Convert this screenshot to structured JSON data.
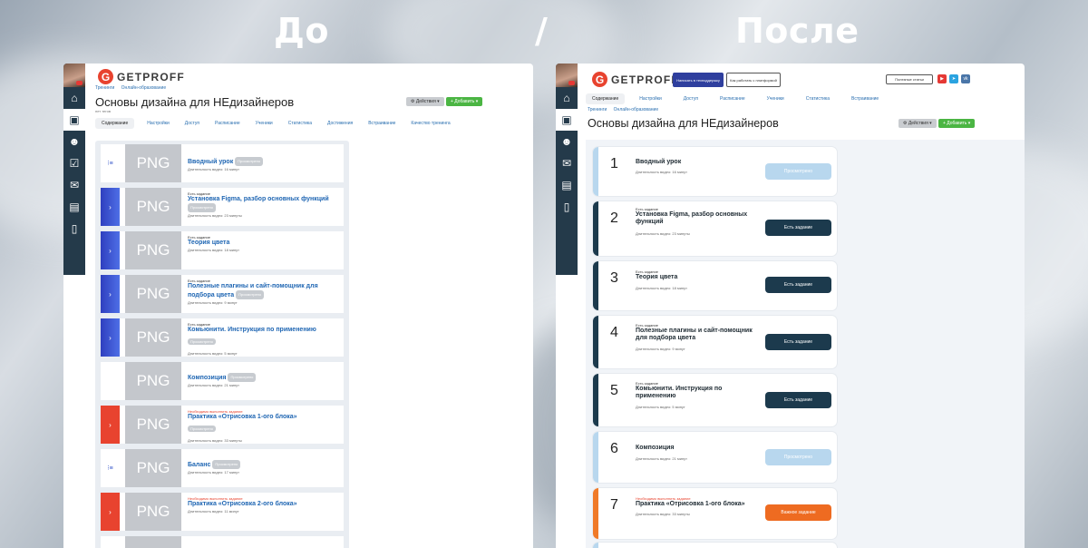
{
  "headings": {
    "before": "До",
    "separator": "/",
    "after": "После"
  },
  "brand": {
    "logo_letter": "G",
    "logo_text": "GETPROFF"
  },
  "colors": {
    "accent_orange": "#e8432f",
    "navy": "#1c3a4d",
    "green": "#4bb543",
    "link_blue": "#1f66b3",
    "light_blue": "#b8d7ee"
  },
  "rail_icons": [
    "home-icon",
    "training-icon",
    "users-icon",
    "tasks-icon",
    "mail-icon",
    "chat-icon",
    "phone-icon"
  ],
  "before": {
    "crumbs": [
      "Тренинги",
      "Онлайн-образование"
    ],
    "title": "Основы дизайна для НЕдизайнеров",
    "subtitle": "нет тегов",
    "actions_label": "Действия",
    "add_label": "+ Добавить",
    "tabs": [
      "Содержание",
      "Настройки",
      "Доступ",
      "Расписание",
      "Ученики",
      "Статистика",
      "Достижения",
      "Встраивание",
      "Качество тренинга"
    ],
    "lessons": [
      {
        "marker": "plain",
        "glyph": "⁝≡",
        "img": "PNG",
        "status": "",
        "title": "Вводный урок",
        "tag": "Просмотрено",
        "dur": "Длительность видео: 16 минут"
      },
      {
        "marker": "blue",
        "glyph": "›",
        "img": "PNG",
        "status": "Есть задание",
        "title": "Установка Figma, разбор основных функций",
        "tag": "Просмотрено",
        "dur": "Длительность видео: 23 минуты"
      },
      {
        "marker": "blue",
        "glyph": "›",
        "img": "PNG",
        "status": "Есть задание",
        "title": "Теория цвета",
        "tag": "",
        "dur": "Длительность видео: 18 минут"
      },
      {
        "marker": "blue",
        "glyph": "›",
        "img": "PNG",
        "status": "Есть задание",
        "title": "Полезные плагины и сайт-помощник для подбора цвета",
        "tag": "Просмотрено",
        "dur": "Длительность видео: 9 минут"
      },
      {
        "marker": "blue",
        "glyph": "›",
        "img": "PNG",
        "status": "Есть задание",
        "title": "Комьюнити. Инструкция по применению",
        "tag": "Просмотрено",
        "dur": "Длительность видео: 5 минут"
      },
      {
        "marker": "plain",
        "glyph": "",
        "img": "PNG",
        "status": "",
        "title": "Композиция",
        "tag": "Просмотрено",
        "dur": "Длительность видео: 21 минут"
      },
      {
        "marker": "red",
        "glyph": "›",
        "img": "PNG",
        "status": "Необходимо выполнить задание",
        "title": "Практика «Отрисовка 1-ого блока»",
        "tag": "Просмотрено",
        "dur": "Длительность видео: 33 минуты"
      },
      {
        "marker": "plain",
        "glyph": "⁝≡",
        "img": "PNG",
        "status": "",
        "title": "Баланс",
        "tag": "Просмотрено",
        "dur": "Длительность видео: 17 минут"
      },
      {
        "marker": "red",
        "glyph": "›",
        "img": "PNG",
        "status": "Необходимо выполнить задание",
        "title": "Практика «Отрисовка 2-ого блока»",
        "tag": "",
        "dur": "Длительность видео: 11 минут"
      },
      {
        "marker": "plain",
        "glyph": "",
        "img": "PNG",
        "status": "",
        "title": "",
        "tag": "",
        "dur": ""
      }
    ]
  },
  "after": {
    "header_buttons": [
      "Написать в техподдержку",
      "Как работать с платформой"
    ],
    "help_button": "Полезные статьи",
    "social": [
      "youtube-icon",
      "telegram-icon",
      "vk-icon"
    ],
    "tabs": [
      "Содержание",
      "Настройки",
      "Доступ",
      "Расписание",
      "Ученики",
      "Статистика",
      "Встраивание"
    ],
    "crumbs": [
      "Тренинги",
      "Онлайн-образование"
    ],
    "title": "Основы дизайна для НЕдизайнеров",
    "actions_label": "Действия",
    "add_label": "+ Добавить",
    "lessons": [
      {
        "num": "1",
        "kind": "light",
        "status": "",
        "title": "Вводный урок",
        "dur": "Длительность видео: 16 минут",
        "button": "Просмотрено"
      },
      {
        "num": "2",
        "kind": "dark",
        "status": "Есть задание",
        "title": "Установка Figma, разбор основных функций",
        "dur": "Длительность видео: 23 минуты",
        "button": "Есть задание"
      },
      {
        "num": "3",
        "kind": "dark",
        "status": "Есть задание",
        "title": "Теория цвета",
        "dur": "Длительность видео: 18 минут",
        "button": "Есть задание"
      },
      {
        "num": "4",
        "kind": "dark",
        "status": "Есть задание",
        "title": "Полезные плагины и сайт-помощник для подбора цвета",
        "dur": "Длительность видео: 9 минут",
        "button": "Есть задание"
      },
      {
        "num": "5",
        "kind": "dark",
        "status": "Есть задание",
        "title": "Комьюнити. Инструкция по применению",
        "dur": "Длительность видео: 5 минут",
        "button": "Есть задание"
      },
      {
        "num": "6",
        "kind": "light",
        "status": "",
        "title": "Композиция",
        "dur": "Длительность видео: 21 минут",
        "button": "Просмотрено"
      },
      {
        "num": "7",
        "kind": "orange",
        "status": "Необходимо выполнить задание",
        "title": "Практика «Отрисовка 1-ого блока»",
        "dur": "Длительность видео: 33 минуты",
        "button": "Важное задание"
      }
    ]
  }
}
